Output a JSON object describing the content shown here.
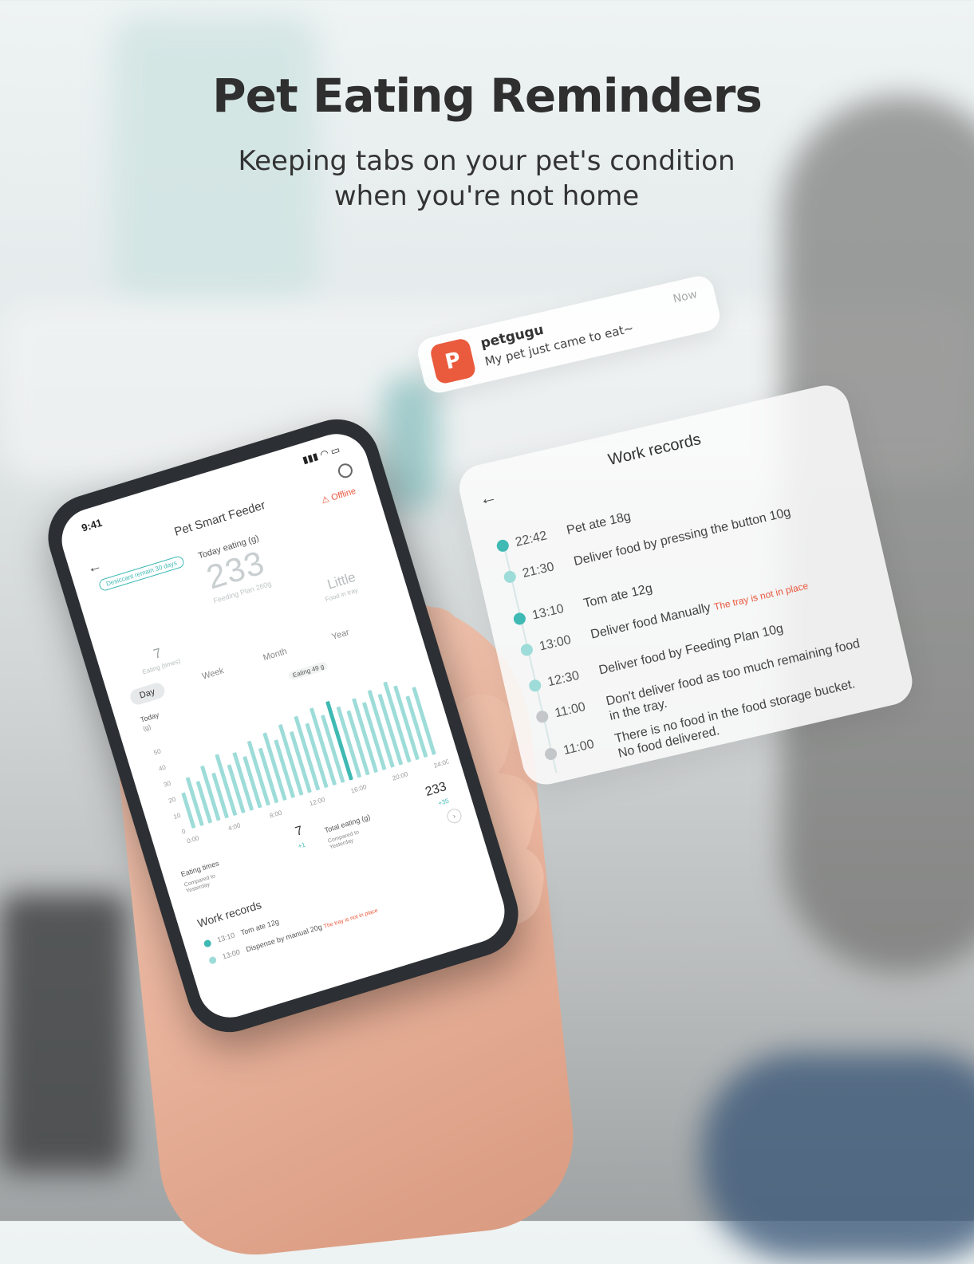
{
  "hero": {
    "title": "Pet Eating Reminders",
    "subtitle_line1": "Keeping tabs on your pet's condition",
    "subtitle_line2": "when you're not home"
  },
  "notification": {
    "app_name": "petgugu",
    "message": "My pet just came to eat~",
    "time": "Now",
    "icon": "petgugu-logo-icon"
  },
  "work_card": {
    "title": "Work records",
    "back_icon": "arrow-left-icon",
    "records": [
      {
        "time": "22:42",
        "text": "Pet ate 18g",
        "warning": "",
        "status": "teal"
      },
      {
        "time": "21:30",
        "text": "Deliver food by pressing the button 10g",
        "warning": "",
        "status": "light"
      },
      {
        "time": "13:10",
        "text": "Tom ate 12g",
        "warning": "",
        "status": "teal"
      },
      {
        "time": "13:00",
        "text": "Deliver food Manually",
        "warning": "The tray is not in place",
        "status": "light"
      },
      {
        "time": "12:30",
        "text": "Deliver food by Feeding Plan 10g",
        "warning": "",
        "status": "light"
      },
      {
        "time": "11:00",
        "text": "Don't deliver food as too much remaining food in the tray.",
        "warning": "",
        "status": "gray"
      },
      {
        "time": "11:00",
        "text": "There is no food in the food storage bucket. No food delivered.",
        "warning": "",
        "status": "gray"
      }
    ]
  },
  "phone": {
    "status_time": "9:41",
    "status_icons": "signal wifi battery",
    "title": "Pet Smart Feeder",
    "offline": "Offline",
    "desiccant": "Desiccant remain 30 days",
    "today_label": "Today eating (g)",
    "today_value": "233",
    "feeding_plan": "Feeding Plan 260g",
    "food_in_tray_value": "Little",
    "food_in_tray_label": "Food in tray",
    "eating_times_value": "7",
    "eating_times_label": "Eating (times)",
    "periods": [
      "Day",
      "Week",
      "Month",
      "Year"
    ],
    "active_period": "Day",
    "chart_today": "Today",
    "chart_unit": "(g)",
    "chart_tooltip": "Eating 49 g",
    "summary": {
      "eating_times_title": "Eating times",
      "eating_times_compare": "Compared to Yesterday",
      "eating_times_value": "7",
      "eating_times_delta": "+1",
      "total_title": "Total eating (g)",
      "total_compare": "Compared to Yesterday",
      "total_value": "233",
      "total_delta": "+35"
    },
    "work_title": "Work records",
    "records": [
      {
        "time": "13:10",
        "text": "Tom ate 12g",
        "warning": ""
      },
      {
        "time": "13:00",
        "text": "Dispense by manual 20g",
        "warning": "The tray is not in place"
      }
    ]
  },
  "chart_data": {
    "type": "bar",
    "title": "",
    "xlabel": "",
    "ylabel": "(g)",
    "ylim": [
      0,
      60
    ],
    "yticks": [
      0,
      10,
      20,
      30,
      40,
      50
    ],
    "xticks": [
      "0:00",
      "4:00",
      "8:00",
      "12:00",
      "16:00",
      "20:00",
      "24:00"
    ],
    "values": [
      22,
      30,
      26,
      34,
      28,
      38,
      30,
      36,
      32,
      40,
      34,
      42,
      36,
      44,
      38,
      46,
      40,
      48,
      42,
      49,
      44,
      40,
      46,
      42,
      48,
      44,
      50,
      46,
      38,
      42
    ],
    "highlight_index": 19,
    "grid": false,
    "colors": {
      "bar": "#9ddcd8",
      "highlight": "#3fb9b3"
    }
  },
  "colors": {
    "accent": "#3fb9b3",
    "warning": "#e8563b",
    "brand": "#ea5a3d"
  }
}
